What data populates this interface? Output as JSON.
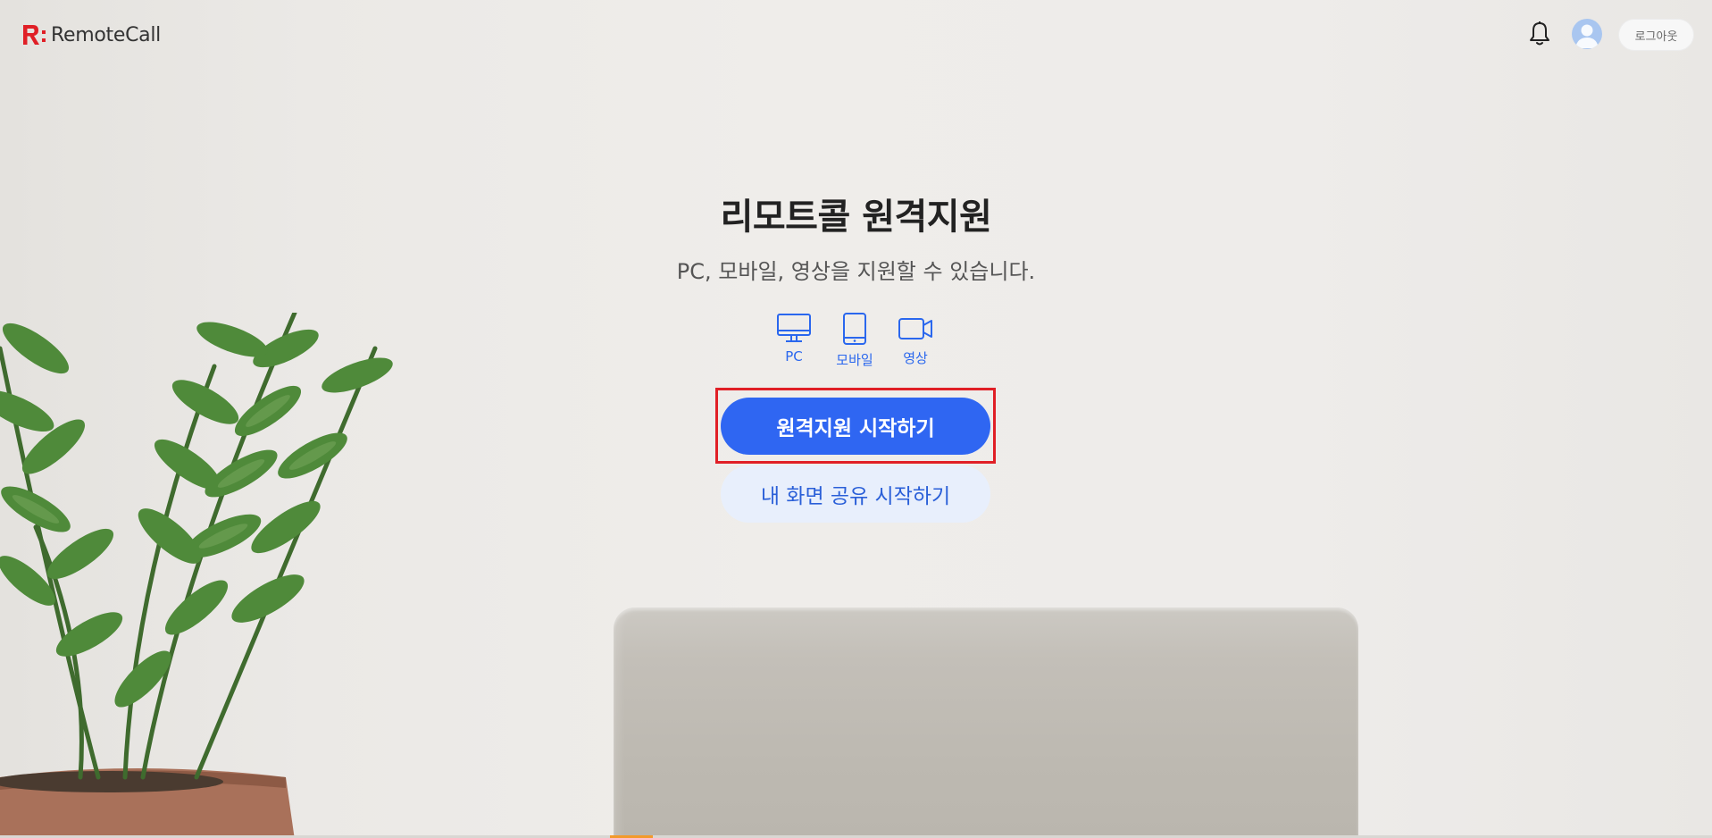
{
  "header": {
    "logo_text": "RemoteCall",
    "logout_label": "로그아웃",
    "icons": [
      "bell-icon",
      "avatar"
    ]
  },
  "main": {
    "title": "리모트콜 원격지원",
    "subtitle": "PC, 모바일, 영상을 지원할 수 있습니다.",
    "features": [
      {
        "label": "PC",
        "icon": "monitor-icon"
      },
      {
        "label": "모바일",
        "icon": "tablet-icon"
      },
      {
        "label": "영상",
        "icon": "video-camera-icon"
      }
    ],
    "primary_button": "원격지원 시작하기",
    "secondary_button": "내 화면 공유 시작하기"
  },
  "colors": {
    "primary": "#2f66f2",
    "secondary_bg": "#e8effc",
    "highlight": "#e01f26",
    "brand_red": "#e01f26"
  }
}
